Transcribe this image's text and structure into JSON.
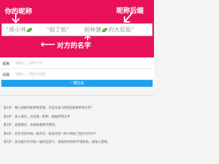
{
  "banner": {
    "callout_name": "你的昵称",
    "callout_suffix": "昵称后缀",
    "callout_other": "对方的名字",
    "pattern_part1": "\"周小帅",
    "pattern_part2": "\"拍了拍\"",
    "pattern_part3": "刻林健",
    "pattern_part4": "的大屁股\"",
    "bg_color": "#e8115a"
  },
  "form": {
    "nickname_label": "昵称",
    "nickname_value": "",
    "nickname_placeholder": "请输入，如周小帅",
    "suffix_label": "后缀",
    "suffix_value": "",
    "suffix_placeholder": "请输入，如的大屁股"
  },
  "button": {
    "label": "一键生成",
    "color": "#1fa1ee"
  },
  "steps": [
    "第1步：输入想要的昵称和后缀，点击生成 (修改后复制所得文字)",
    "第2步：进入微信，点击我—昵称，粘贴所得文字",
    "第3步：返回微信，并被拍者即可看到。",
    "第4步：您在对话中拍一拍对方，就会出现 \"周小帅拍了拍对方的XX\"",
    "第5步：该功能只针对拍一拍的自定义，系统原有昵称不受影响，请放心使用。"
  ]
}
